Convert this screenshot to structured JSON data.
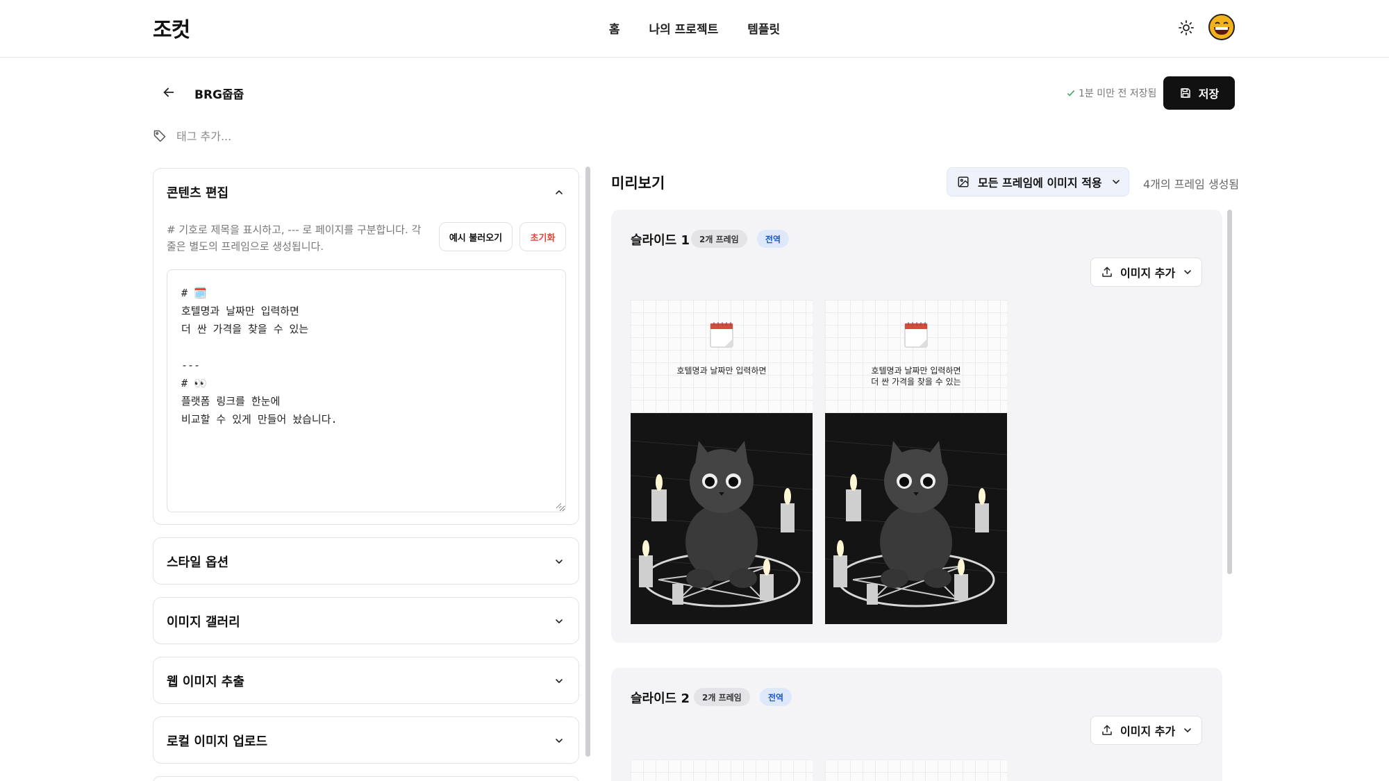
{
  "app": {
    "logo": "조컷",
    "nav": [
      "홈",
      "나의 프로젝트",
      "템플릿"
    ]
  },
  "header": {
    "title": "BRG줍줍",
    "saved_status": "1분 미만 전 저장됨",
    "save_label": "저장",
    "tag_placeholder": "태그 추가..."
  },
  "content_panel": {
    "title": "콘텐츠 편집",
    "helper": "# 기호로 제목을 표시하고, --- 로 페이지를 구분합니다. 각 줄은 별도의 프레임으로 생성됩니다.",
    "example_button": "예시 불러오기",
    "reset_button": "초기화",
    "editor_text": "# 🗓️\n호텔명과 날짜만 입력하면\n더 싼 가격을 찾을 수 있는\n\n---\n# 👀\n플랫폼 링크를 한눈에\n비교할 수 있게 만들어 놨습니다."
  },
  "collapsed_panels": [
    "스타일 옵션",
    "이미지 갤러리",
    "웹 이미지 추출",
    "로컬 이미지 업로드"
  ],
  "preview": {
    "title": "미리보기",
    "apply_all": "모든 프레임에 이미지 적용",
    "frame_count": "4개의 프레임 생성됨",
    "add_image_label": "이미지 추가",
    "slides": [
      {
        "title": "슬라이드 1",
        "frames_badge": "2개 프레임",
        "scope_badge": "전역",
        "frames": [
          {
            "text": "호텔명과 날짜만 입력하면"
          },
          {
            "text": "호텔명과 날짜만 입력하면\n더 싼 가격을 찾을 수 있는"
          }
        ]
      },
      {
        "title": "슬라이드 2",
        "frames_badge": "2개 프레임",
        "scope_badge": "전역"
      }
    ]
  },
  "icons": {
    "theme": "sun-icon",
    "back": "arrow-left-icon",
    "tag": "tag-icon",
    "save": "floppy-disk-icon",
    "check": "check-icon",
    "apply": "image-icon",
    "upload": "upload-icon",
    "chevron": "chevron-down-icon"
  },
  "colors": {
    "primary_button": "#111111",
    "badge_blue_text": "#1e55c9",
    "reset_red": "#e0453a",
    "saved_check": "#2e9e5b"
  }
}
